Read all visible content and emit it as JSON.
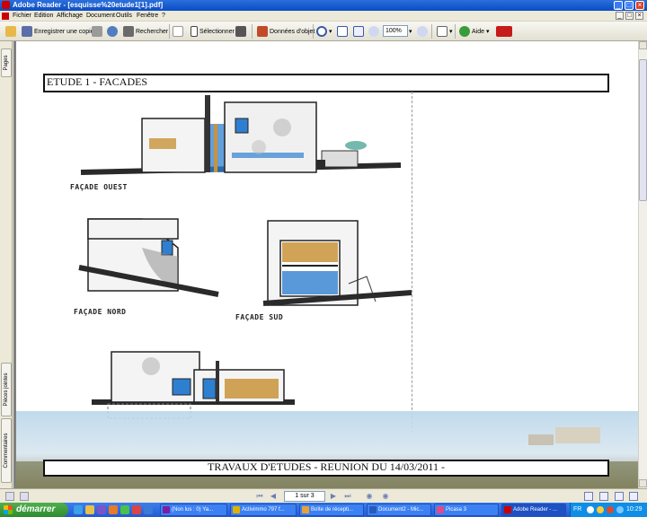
{
  "window": {
    "title": "Adobe Reader - [esquisse%20etude1[1].pdf]",
    "controls": [
      "_",
      "□",
      "×"
    ]
  },
  "menu": {
    "items": [
      "Fichier",
      "Edition",
      "Affichage",
      "Document",
      "Outils",
      "Fenêtre",
      "?"
    ],
    "doc_controls": [
      "_",
      "□",
      "×"
    ]
  },
  "toolbar": {
    "save_copy_label": "Enregistrer une copie",
    "search_label": "Rechercher",
    "select_label": "Sélectionner",
    "object_data_label": "Données d'objet",
    "zoom_value": "100%",
    "help_label": "Aide"
  },
  "left_panel": {
    "tabs": [
      "Pages",
      "Pièces jointes",
      "Commentaires"
    ]
  },
  "document": {
    "header_title": "ETUDE 1 - FACADES",
    "footer_title": "TRAVAUX D'ETUDES - REUNION DU 14/03/2011 -",
    "sketch_labels": [
      "FAÇADE OUEST",
      "FAÇADE NORD",
      "FAÇADE SUD"
    ]
  },
  "statusbar": {
    "page_indicator": "1 sur 3"
  },
  "taskbar": {
    "start_label": "démarrer",
    "tasks": [
      {
        "label": "(Non lus : 0) Ya..."
      },
      {
        "label": "Activimmo 797 f..."
      },
      {
        "label": "Boîte de récepti..."
      },
      {
        "label": "Document2 - Mic..."
      },
      {
        "label": "Picasa 3"
      },
      {
        "label": "Adobe Reader - ..."
      }
    ],
    "tray_lang": "FR",
    "clock": "10:29"
  },
  "colors": {
    "titlebar": "#0a4bc4",
    "taskbar": "#2458d1",
    "start_button": "#2f8a2f",
    "sketch_wood": "#c8933a",
    "sketch_glass": "#2f7fd0"
  }
}
